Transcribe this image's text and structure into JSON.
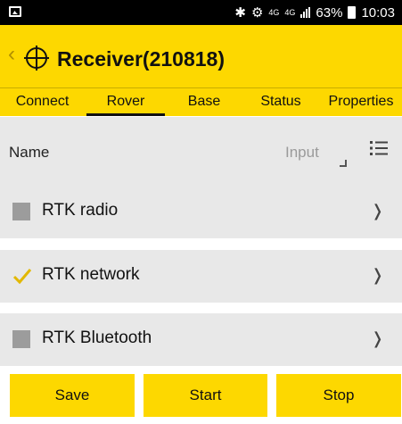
{
  "statusbar": {
    "network_4g_a": "4G",
    "network_4g_b": "4G",
    "battery": "63%",
    "time": "10:03"
  },
  "header": {
    "title": "Receiver(210818)"
  },
  "tabs": [
    {
      "label": "Connect",
      "active": false
    },
    {
      "label": "Rover",
      "active": true
    },
    {
      "label": "Base",
      "active": false
    },
    {
      "label": "Status",
      "active": false
    },
    {
      "label": "Properties",
      "active": false
    }
  ],
  "name_field": {
    "label": "Name",
    "placeholder": "Input"
  },
  "options": [
    {
      "label": "RTK radio",
      "checked": false
    },
    {
      "label": "RTK network",
      "checked": true
    },
    {
      "label": "RTK Bluetooth",
      "checked": false
    }
  ],
  "buttons": {
    "save": "Save",
    "start": "Start",
    "stop": "Stop"
  },
  "colors": {
    "accent": "#fdd800",
    "row_bg": "#e8e8e8"
  }
}
